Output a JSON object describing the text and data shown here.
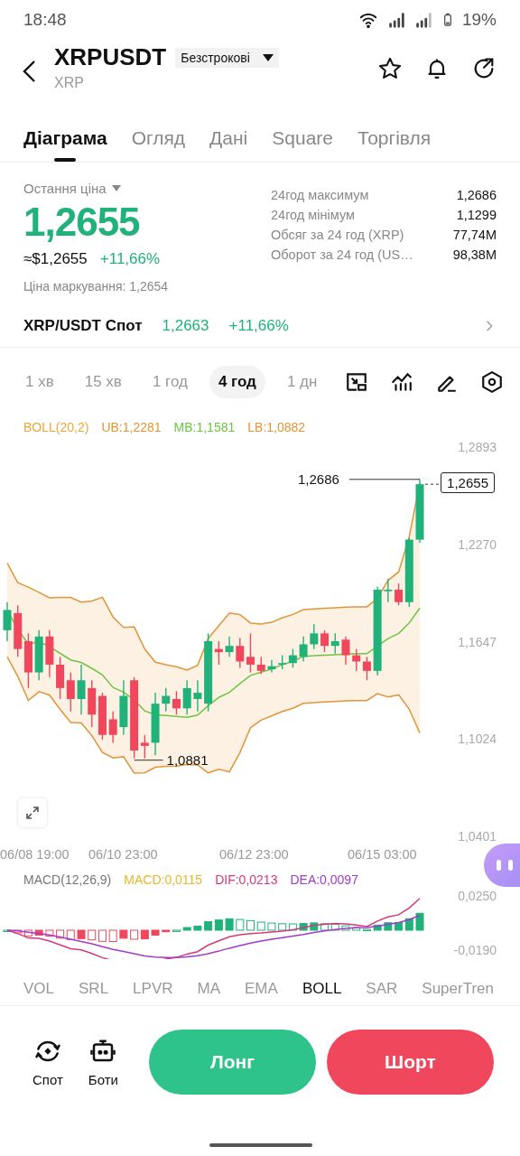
{
  "status_bar": {
    "time": "18:48",
    "battery": "19%"
  },
  "header": {
    "title": "XRPUSDT",
    "contract_type": "Безстрокові",
    "subtitle": "XRP"
  },
  "tabs": [
    {
      "label": "Діаграма",
      "selected": true
    },
    {
      "label": "Огляд",
      "selected": false
    },
    {
      "label": "Дані",
      "selected": false
    },
    {
      "label": "Square",
      "selected": false
    },
    {
      "label": "Торгівля",
      "selected": false
    }
  ],
  "price": {
    "label": "Остання ціна",
    "last": "1,2655",
    "usd": "≈$1,2655",
    "change": "+11,66%",
    "mark_price": "Ціна маркування: 1,2654"
  },
  "stats": [
    {
      "label": "24год максимум",
      "value": "1,2686"
    },
    {
      "label": "24год мінімум",
      "value": "1,1299"
    },
    {
      "label": "Обсяг за 24 год (XRP)",
      "value": "77,74M"
    },
    {
      "label": "Оборот за 24 год (US…",
      "value": "98,38M"
    }
  ],
  "spot": {
    "label": "XRP/USDT Спот",
    "price": "1,2663",
    "change": "+11,66%"
  },
  "timeframes": [
    {
      "label": "1 хв",
      "selected": false
    },
    {
      "label": "15 хв",
      "selected": false
    },
    {
      "label": "1 год",
      "selected": false
    },
    {
      "label": "4 год",
      "selected": true
    },
    {
      "label": "1 дн",
      "selected": false
    }
  ],
  "chart": {
    "legend": [
      {
        "text": "BOLL(20,2)",
        "color": "#e8a93a"
      },
      {
        "text": "UB:1,2281",
        "color": "#e0963a"
      },
      {
        "text": "MB:1,1581",
        "color": "#6cc644"
      },
      {
        "text": "LB:1,0882",
        "color": "#e0963a"
      }
    ],
    "y_ticks": [
      "1,2893",
      "1,2270",
      "1,1647",
      "1,1024",
      "1,0401"
    ],
    "high_label": "1,2686",
    "low_label": "1,0881",
    "last_price": "1,2655",
    "x_labels": [
      "06/08 19:00",
      "06/10 23:00",
      "06/12 23:00",
      "06/15 03:00"
    ]
  },
  "macd": {
    "legend": [
      {
        "text": "MACD(12,26,9)",
        "color": "#777777"
      },
      {
        "text": "MACD:0,0115",
        "color": "#e8b62a"
      },
      {
        "text": "DIF:0,0213",
        "color": "#d6397a"
      },
      {
        "text": "DEA:0,0097",
        "color": "#a03cc8"
      }
    ],
    "y_ticks": [
      "0,0250",
      "-0,0190"
    ]
  },
  "indicators": [
    {
      "label": "VOL",
      "selected": false
    },
    {
      "label": "SRL",
      "selected": false
    },
    {
      "label": "LPVR",
      "selected": false
    },
    {
      "label": "MA",
      "selected": false
    },
    {
      "label": "EMA",
      "selected": false
    },
    {
      "label": "BOLL",
      "selected": true
    },
    {
      "label": "SAR",
      "selected": false
    },
    {
      "label": "SuperTren",
      "selected": false
    }
  ],
  "actions": {
    "links": [
      {
        "label": "Спот",
        "kind": "spot"
      },
      {
        "label": "Боти",
        "kind": "bots"
      }
    ],
    "long": "Лонг",
    "short": "Шорт"
  }
}
